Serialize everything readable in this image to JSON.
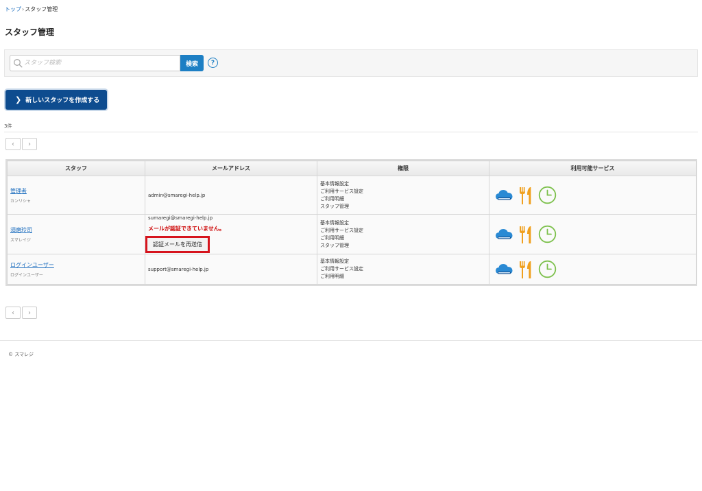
{
  "breadcrumb": {
    "home": "トップ",
    "separator": "›",
    "current": "スタッフ管理"
  },
  "page_title": "スタッフ管理",
  "search": {
    "placeholder": "スタッフ検索",
    "value": "",
    "button_label": "検索",
    "help_label": "?"
  },
  "create_button_label": "新しいスタッフを作成する",
  "count_label": "3件",
  "pager": {
    "prev": "‹",
    "next": "›"
  },
  "table": {
    "headers": [
      "スタッフ",
      "メールアドレス",
      "権限",
      "利用可能サービス"
    ],
    "rows": [
      {
        "name": "管理者",
        "kana": "カンリシャ",
        "email": "admin@smaregi-help.jp",
        "warning": "",
        "resend_label": "",
        "permissions": [
          "基本情報設定",
          "ご利用サービス設定",
          "ご利用明細",
          "スタッフ管理"
        ]
      },
      {
        "name": "須磨玲司",
        "kana": "スマレイジ",
        "email": "sumaregi@smaregi-help.jp",
        "warning": "メールが認証できていません。",
        "resend_label": "認証メールを再送信",
        "permissions": [
          "基本情報設定",
          "ご利用サービス設定",
          "ご利用明細",
          "スタッフ管理"
        ]
      },
      {
        "name": "ログインユーザー",
        "kana": "ログインユーザー",
        "email": "support@smaregi-help.jp",
        "warning": "",
        "resend_label": "",
        "permissions": [
          "基本情報設定",
          "ご利用サービス設定",
          "ご利用明細"
        ]
      }
    ]
  },
  "service_icons": [
    "cloud-icon",
    "fork-knife-icon",
    "clock-icon"
  ],
  "colors": {
    "link": "#1f6fbf",
    "primary": "#0e4c8f",
    "search_button": "#1d7fc4",
    "warning": "#cc0000",
    "highlight": "#d6141d",
    "cloud": "#2a8ad4",
    "utensils": "#f0a01e",
    "clock": "#7cc04b"
  },
  "footer": {
    "copyright": "© スマレジ"
  }
}
